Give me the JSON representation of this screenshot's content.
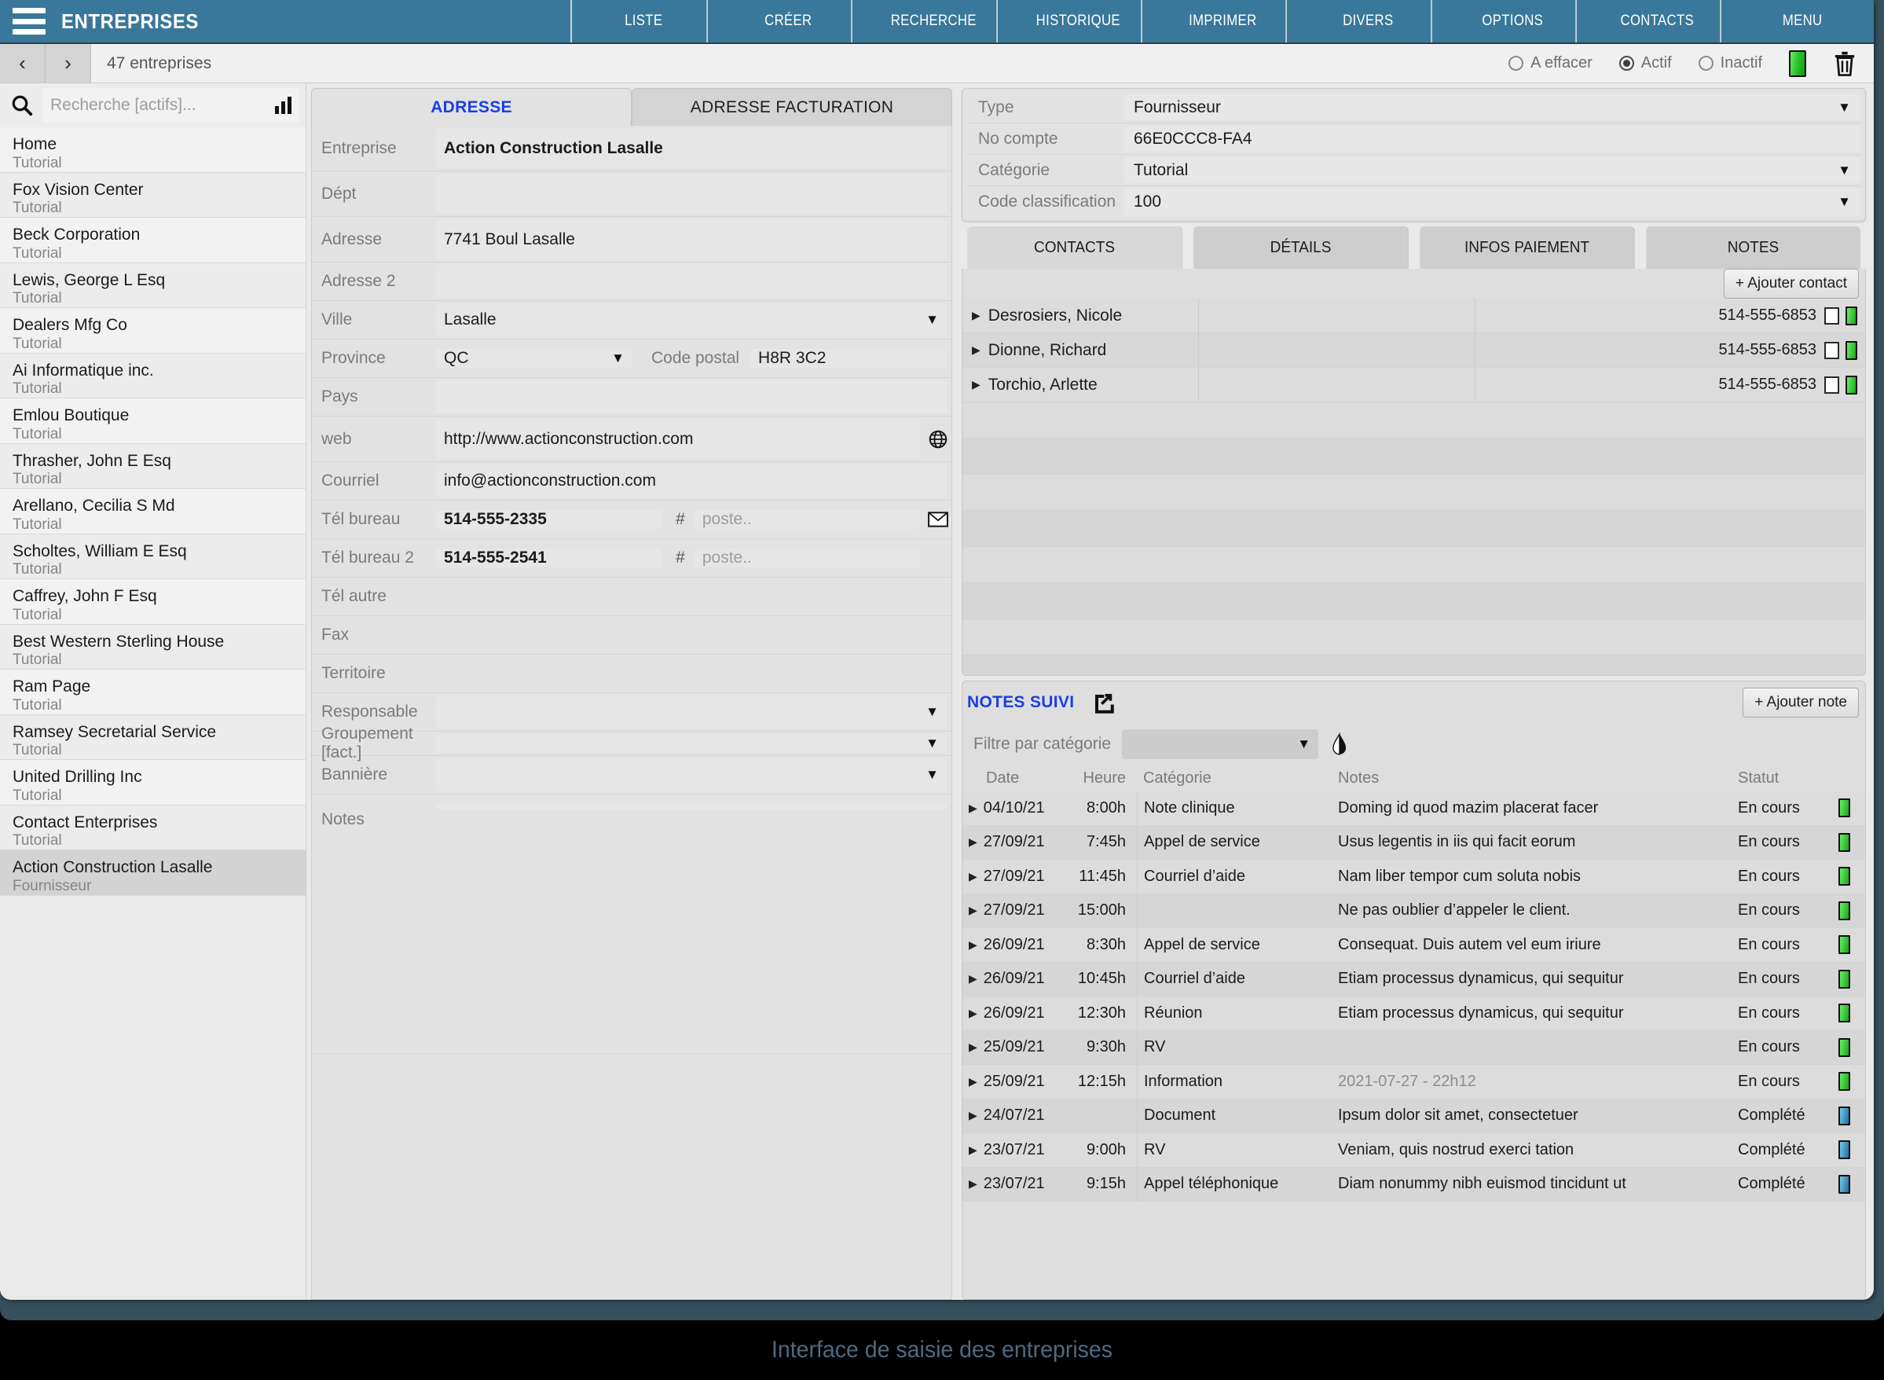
{
  "header": {
    "title": "ENTREPRISES",
    "nav_items": [
      "LISTE",
      "CRÉER",
      "RECHERCHE",
      "HISTORIQUE",
      "IMPRIMER",
      "DIVERS",
      "OPTIONS",
      "CONTACTS",
      "MENU"
    ]
  },
  "subbar": {
    "prev": "‹",
    "next": "›",
    "count_label": "47 entreprises",
    "radios": [
      {
        "label": "A effacer",
        "selected": false
      },
      {
        "label": "Actif",
        "selected": true
      },
      {
        "label": "Inactif",
        "selected": false
      }
    ]
  },
  "sidebar": {
    "search_placeholder": "Recherche [actifs]...",
    "search_value": "",
    "items": [
      {
        "name": "Home",
        "category": "Tutorial",
        "selected": false
      },
      {
        "name": "Fox Vision Center",
        "category": "Tutorial",
        "selected": false
      },
      {
        "name": "Beck Corporation",
        "category": "Tutorial",
        "selected": false
      },
      {
        "name": "Lewis, George L Esq",
        "category": "Tutorial",
        "selected": false
      },
      {
        "name": "Dealers Mfg Co",
        "category": "Tutorial",
        "selected": false
      },
      {
        "name": "Ai Informatique inc.",
        "category": "Tutorial",
        "selected": false
      },
      {
        "name": "Emlou Boutique",
        "category": "Tutorial",
        "selected": false
      },
      {
        "name": "Thrasher, John E Esq",
        "category": "Tutorial",
        "selected": false
      },
      {
        "name": "Arellano, Cecilia S Md",
        "category": "Tutorial",
        "selected": false
      },
      {
        "name": "Scholtes, William E Esq",
        "category": "Tutorial",
        "selected": false
      },
      {
        "name": "Caffrey, John F Esq",
        "category": "Tutorial",
        "selected": false
      },
      {
        "name": "Best Western Sterling House",
        "category": "Tutorial",
        "selected": false
      },
      {
        "name": "Ram Page",
        "category": "Tutorial",
        "selected": false
      },
      {
        "name": "Ramsey Secretarial Service",
        "category": "Tutorial",
        "selected": false
      },
      {
        "name": "United Drilling Inc",
        "category": "Tutorial",
        "selected": false
      },
      {
        "name": "Contact Enterprises",
        "category": "Tutorial",
        "selected": false
      },
      {
        "name": "Action Construction Lasalle",
        "category": "Fournisseur",
        "selected": true
      }
    ]
  },
  "address_panel": {
    "tabs": [
      {
        "label": "ADRESSE",
        "active": true
      },
      {
        "label": "ADRESSE FACTURATION",
        "active": false
      }
    ],
    "fields": {
      "entreprise_label": "Entreprise",
      "entreprise_value": "Action Construction Lasalle",
      "dept_label": "Dépt",
      "dept_value": "",
      "adresse_label": "Adresse",
      "adresse_value": "7741 Boul Lasalle",
      "adresse2_label": "Adresse 2",
      "adresse2_value": "",
      "ville_label": "Ville",
      "ville_value": "Lasalle",
      "province_label": "Province",
      "province_value": "QC",
      "code_postal_label": "Code postal",
      "code_postal_value": "H8R 3C2",
      "pays_label": "Pays",
      "pays_value": "",
      "web_label": "web",
      "web_value": "http://www.actionconstruction.com",
      "courriel_label": "Courriel",
      "courriel_value": "info@actionconstruction.com",
      "tel_bureau_label": "Tél bureau",
      "tel_bureau_value": "514-555-2335",
      "tel_bureau_poste_placeholder": "poste..",
      "tel_bureau2_label": "Tél bureau 2",
      "tel_bureau2_value": "514-555-2541",
      "tel_bureau2_poste_placeholder": "poste..",
      "tel_autre_label": "Tél autre",
      "tel_autre_value": "",
      "fax_label": "Fax",
      "fax_value": "",
      "territoire_label": "Territoire",
      "territoire_value": "",
      "responsable_label": "Responsable",
      "responsable_value": "",
      "groupement_label": "Groupement [fact.]",
      "groupement_value": "",
      "banniere_label": "Bannière",
      "banniere_value": "",
      "notes_label": "Notes",
      "notes_value": "",
      "hash_symbol": "#"
    }
  },
  "type_panel": {
    "rows": [
      {
        "label": "Type",
        "value": "Fournisseur",
        "dropdown": true
      },
      {
        "label": "No compte",
        "value": "66E0CCC8-FA4",
        "dropdown": false
      },
      {
        "label": "Catégorie",
        "value": "Tutorial",
        "dropdown": true
      },
      {
        "label": "Code classification",
        "value": "100",
        "dropdown": true
      }
    ]
  },
  "contacts_panel": {
    "tabs": [
      {
        "label": "CONTACTS",
        "active": true
      },
      {
        "label": "DÉTAILS",
        "active": false
      },
      {
        "label": "INFOS PAIEMENT",
        "active": false
      },
      {
        "label": "NOTES",
        "active": false
      }
    ],
    "add_button": "+ Ajouter contact",
    "rows": [
      {
        "name": "Desrosiers, Nicole",
        "phone": "514-555-6853"
      },
      {
        "name": "Dionne, Richard",
        "phone": "514-555-6853"
      },
      {
        "name": "Torchio, Arlette",
        "phone": "514-555-6853"
      }
    ]
  },
  "notes_panel": {
    "title": "NOTES SUIVI",
    "add_button": "+ Ajouter note",
    "filter_label": "Filtre par catégorie",
    "filter_value": "",
    "columns": [
      "Date",
      "Heure",
      "Catégorie",
      "Notes",
      "Statut"
    ],
    "rows": [
      {
        "date": "04/10/21",
        "heure": "8:00h",
        "categorie": "Note clinique",
        "notes": "Doming id quod mazim placerat facer",
        "statut": "En cours",
        "led": "green",
        "muted": false
      },
      {
        "date": "27/09/21",
        "heure": "7:45h",
        "categorie": "Appel de service",
        "notes": "Usus legentis in iis qui facit eorum",
        "statut": "En cours",
        "led": "green",
        "muted": false
      },
      {
        "date": "27/09/21",
        "heure": "11:45h",
        "categorie": "Courriel d’aide",
        "notes": "Nam liber tempor cum soluta nobis",
        "statut": "En cours",
        "led": "green",
        "muted": false
      },
      {
        "date": "27/09/21",
        "heure": "15:00h",
        "categorie": "",
        "notes": "Ne pas oublier d’appeler le client.",
        "statut": "En cours",
        "led": "green",
        "muted": false
      },
      {
        "date": "26/09/21",
        "heure": "8:30h",
        "categorie": "Appel de service",
        "notes": "Consequat. Duis autem vel eum iriure",
        "statut": "En cours",
        "led": "green",
        "muted": false
      },
      {
        "date": "26/09/21",
        "heure": "10:45h",
        "categorie": "Courriel d’aide",
        "notes": "Etiam processus dynamicus, qui sequitur",
        "statut": "En cours",
        "led": "green",
        "muted": false
      },
      {
        "date": "26/09/21",
        "heure": "12:30h",
        "categorie": "Réunion",
        "notes": "Etiam processus dynamicus, qui sequitur",
        "statut": "En cours",
        "led": "green",
        "muted": false
      },
      {
        "date": "25/09/21",
        "heure": "9:30h",
        "categorie": "RV",
        "notes": "",
        "statut": "En cours",
        "led": "green",
        "muted": false
      },
      {
        "date": "25/09/21",
        "heure": "12:15h",
        "categorie": "Information",
        "notes": "2021-07-27 - 22h12",
        "statut": "En cours",
        "led": "green",
        "muted": true
      },
      {
        "date": "24/07/21",
        "heure": "",
        "categorie": "Document",
        "notes": "Ipsum dolor sit amet, consectetuer",
        "statut": "Complété",
        "led": "blue",
        "muted": false
      },
      {
        "date": "23/07/21",
        "heure": "9:00h",
        "categorie": "RV",
        "notes": "Veniam, quis nostrud exerci tation",
        "statut": "Complété",
        "led": "blue",
        "muted": false
      },
      {
        "date": "23/07/21",
        "heure": "9:15h",
        "categorie": "Appel téléphonique",
        "notes": "Diam nonummy nibh euismod tincidunt ut",
        "statut": "Complété",
        "led": "blue",
        "muted": false
      }
    ]
  },
  "footer": {
    "caption": "Interface de saisie des entreprises"
  },
  "colors": {
    "brand": "#39789a",
    "accent_blue": "#1a3fe0",
    "footer_text": "#4f6a80",
    "led_green": "#2ec82e",
    "led_blue": "#1d6ea3"
  }
}
